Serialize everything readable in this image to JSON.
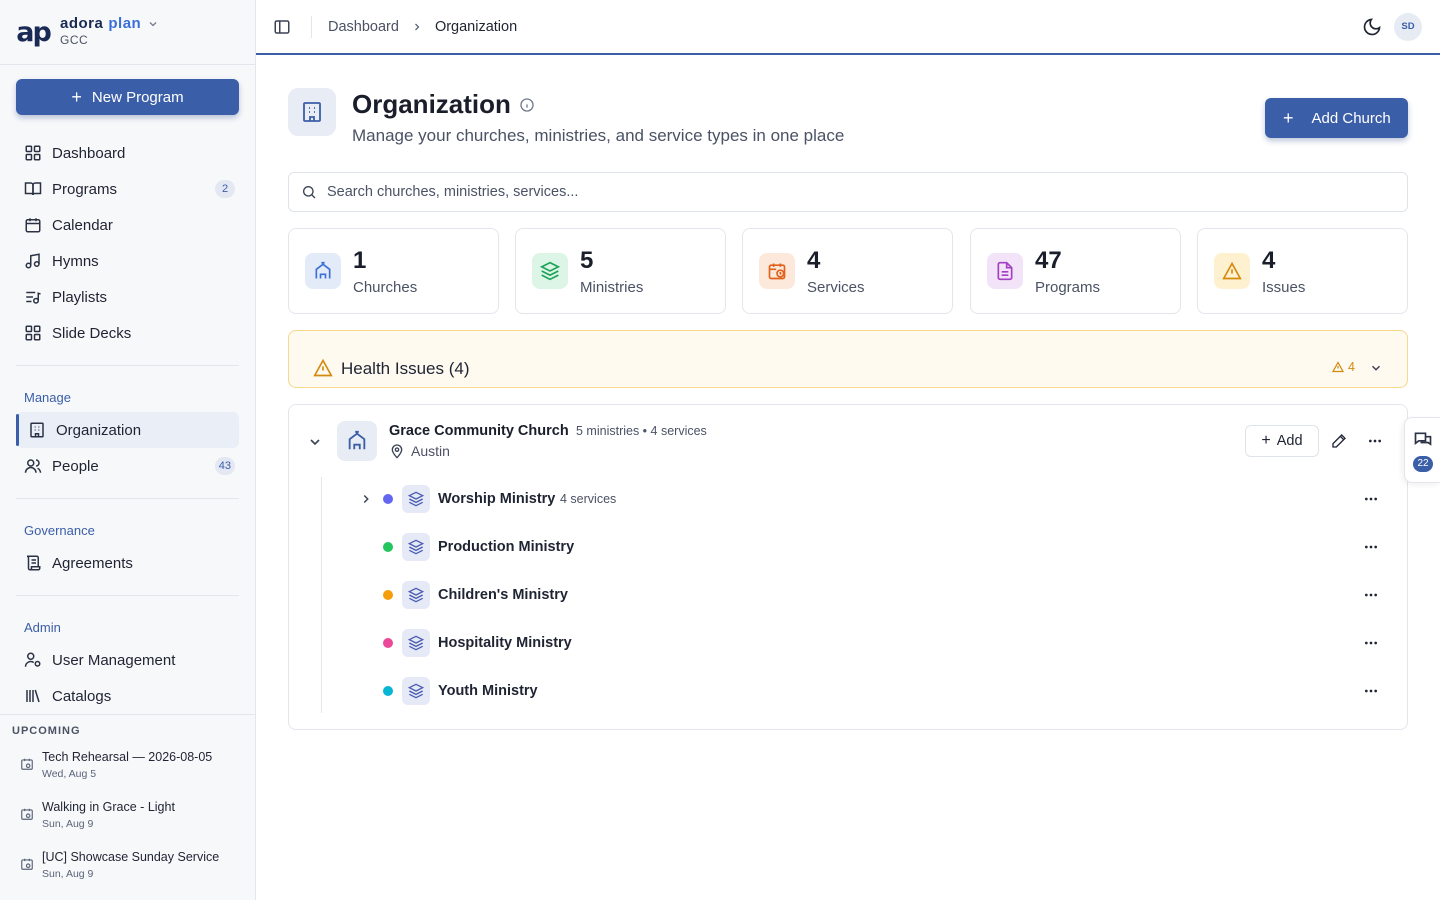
{
  "brand": {
    "logo_text": "ap",
    "name": "adora",
    "name_accent": "plan",
    "org": "GCC"
  },
  "sidebar": {
    "new_program_label": "New Program",
    "main_items": [
      {
        "label": "Dashboard",
        "icon": "grid-icon"
      },
      {
        "label": "Programs",
        "icon": "book-icon",
        "count": "2"
      },
      {
        "label": "Calendar",
        "icon": "calendar-icon"
      },
      {
        "label": "Hymns",
        "icon": "music-icon"
      },
      {
        "label": "Playlists",
        "icon": "playlist-icon"
      },
      {
        "label": "Slide Decks",
        "icon": "slides-icon"
      }
    ],
    "manage_label": "Manage",
    "manage_items": [
      {
        "label": "Organization",
        "icon": "building-icon",
        "active": true
      },
      {
        "label": "People",
        "icon": "people-icon",
        "count": "43"
      }
    ],
    "governance_label": "Governance",
    "governance_items": [
      {
        "label": "Agreements",
        "icon": "scroll-icon"
      }
    ],
    "admin_label": "Admin",
    "admin_items": [
      {
        "label": "User Management",
        "icon": "user-cog-icon"
      },
      {
        "label": "Catalogs",
        "icon": "library-icon"
      }
    ],
    "upcoming_title": "UPCOMING",
    "upcoming": [
      {
        "title": "Tech Rehearsal — 2026-08-05",
        "date": "Wed, Aug 5"
      },
      {
        "title": "Walking in Grace - Light",
        "date": "Sun, Aug 9"
      },
      {
        "title": "[UC] Showcase Sunday Service",
        "date": "Sun, Aug 9"
      }
    ]
  },
  "topbar": {
    "breadcrumb": [
      "Dashboard",
      "Organization"
    ],
    "avatar_initials": "SD"
  },
  "page": {
    "title": "Organization",
    "subtitle": "Manage your churches, ministries, and service types in one place",
    "add_church_label": "Add Church",
    "search_placeholder": "Search churches, ministries, services..."
  },
  "stats": [
    {
      "value": "1",
      "label": "Churches",
      "icon": "church-icon",
      "bg": "#e3ebf9",
      "fg": "#3b6fd6"
    },
    {
      "value": "5",
      "label": "Ministries",
      "icon": "layers-icon",
      "bg": "#dcf5e6",
      "fg": "#1ea35a"
    },
    {
      "value": "4",
      "label": "Services",
      "icon": "calendar-clock-icon",
      "bg": "#fde8dc",
      "fg": "#e0621c"
    },
    {
      "value": "47",
      "label": "Programs",
      "icon": "document-icon",
      "bg": "#f3e3f8",
      "fg": "#a23fc4"
    },
    {
      "value": "4",
      "label": "Issues",
      "icon": "warning-icon",
      "bg": "#fdf1cf",
      "fg": "#d48a10"
    }
  ],
  "health": {
    "title": "Health Issues (4)",
    "count": "4"
  },
  "church": {
    "name": "Grace Community Church",
    "meta": "5 ministries • 4 services",
    "location": "Austin",
    "add_label": "Add",
    "ministries": [
      {
        "name": "Worship Ministry",
        "meta": "4 services",
        "color": "#6366f1",
        "expandable": true
      },
      {
        "name": "Production Ministry",
        "meta": "",
        "color": "#22c55e"
      },
      {
        "name": "Children's Ministry",
        "meta": "",
        "color": "#f59e0b"
      },
      {
        "name": "Hospitality Ministry",
        "meta": "",
        "color": "#ec4899"
      },
      {
        "name": "Youth Ministry",
        "meta": "",
        "color": "#06b6d4"
      }
    ]
  },
  "chat": {
    "count": "22"
  }
}
